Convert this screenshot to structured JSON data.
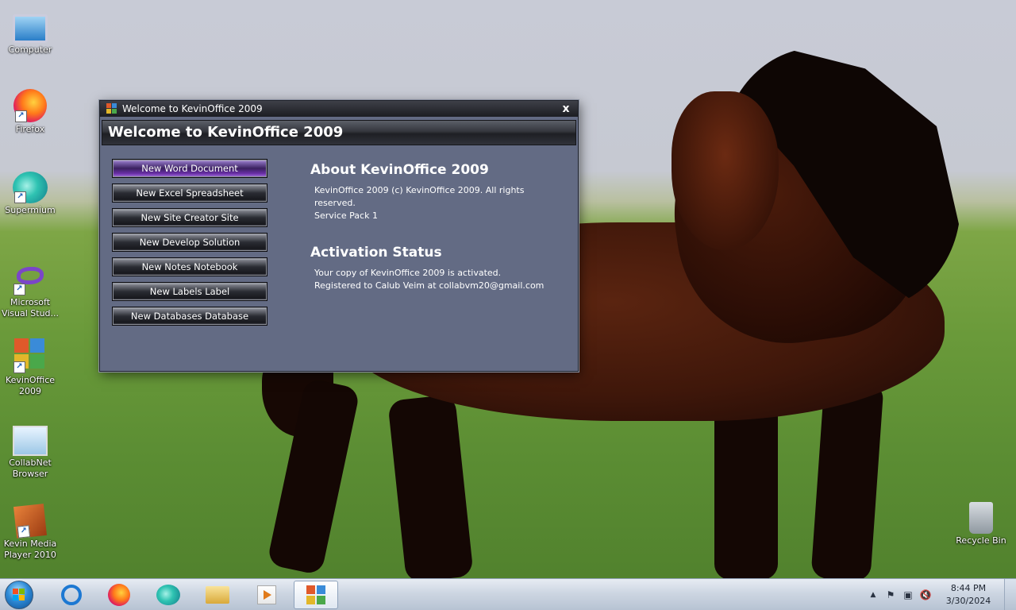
{
  "desktop": {
    "icons": [
      {
        "label": "Computer",
        "icon": "computer-icon"
      },
      {
        "label": "Firefox",
        "icon": "firefox-icon"
      },
      {
        "label": "Supermium",
        "icon": "supermium-icon"
      },
      {
        "label": "Microsoft Visual Stud...",
        "icon": "visual-studio-icon"
      },
      {
        "label": "KevinOffice 2009",
        "icon": "kevinoffice-icon"
      },
      {
        "label": "CollabNet Browser",
        "icon": "collabnet-browser-icon"
      },
      {
        "label": "Kevin Media Player 2010",
        "icon": "kevin-media-player-icon"
      },
      {
        "label": "Recycle Bin",
        "icon": "recycle-bin-icon"
      }
    ]
  },
  "window": {
    "title": "Welcome to KevinOffice 2009",
    "close_glyph": "x",
    "banner": "Welcome to KevinOffice 2009",
    "actions": [
      {
        "label": "New Word Document",
        "active": true
      },
      {
        "label": "New Excel Spreadsheet",
        "active": false
      },
      {
        "label": "New Site Creator Site",
        "active": false
      },
      {
        "label": "New Develop Solution",
        "active": false
      },
      {
        "label": "New Notes Notebook",
        "active": false
      },
      {
        "label": "New Labels Label",
        "active": false
      },
      {
        "label": "New Databases Database",
        "active": false
      }
    ],
    "about": {
      "heading": "About KevinOffice 2009",
      "line1": "KevinOffice 2009 (c) KevinOffice 2009. All rights reserved.",
      "line2": "Service Pack 1"
    },
    "activation": {
      "heading": "Activation Status",
      "line1": "Your copy of KevinOffice 2009 is activated.",
      "line2": "Registered to Calub Veim at collabvm20@gmail.com"
    }
  },
  "taskbar": {
    "pinned": [
      "internet-explorer-icon",
      "firefox-icon",
      "supermium-icon",
      "file-explorer-icon",
      "media-player-icon",
      "kevinoffice-icon"
    ],
    "tray": {
      "show_hidden": "▲",
      "flag": "⚑",
      "network": "▣",
      "volume": "🔇"
    },
    "clock": {
      "time": "8:44 PM",
      "date": "3/30/2024"
    }
  },
  "colors": {
    "window_bg": "#636b84",
    "active_button": "#6a2fa8",
    "taskbar": "#cdd6e2"
  }
}
